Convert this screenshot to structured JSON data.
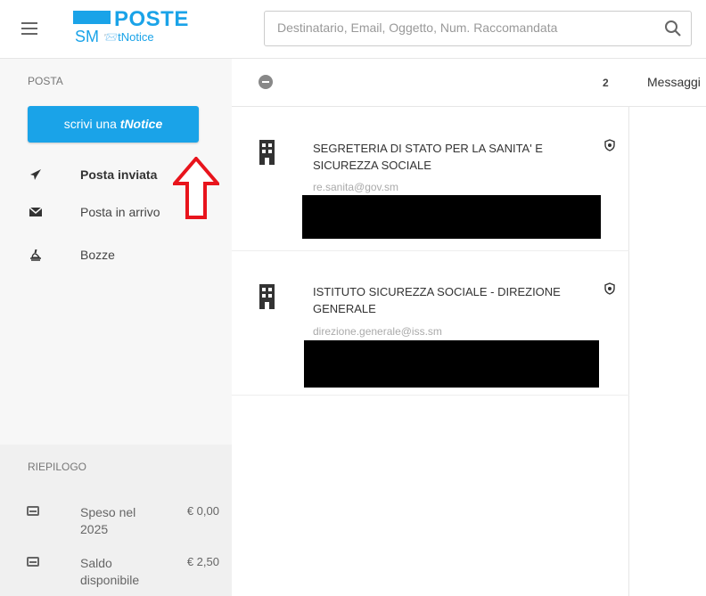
{
  "header": {
    "logo_poste": "POSTE",
    "logo_sm": "SM",
    "logo_tnotice": "📨tNotice",
    "search_placeholder": "Destinatario, Email, Oggetto, Num. Raccomandata"
  },
  "sidebar": {
    "section_label": "POSTA",
    "compose_prefix": "scrivi una ",
    "compose_brand": "tNotice",
    "items": [
      {
        "label": "Posta inviata",
        "icon": "send-icon",
        "active": true
      },
      {
        "label": "Posta in arrivo",
        "icon": "envelope-icon",
        "active": false
      },
      {
        "label": "Bozze",
        "icon": "drafts-icon",
        "active": false
      }
    ],
    "summary_label": "RIEPILOGO",
    "summary": [
      {
        "label": "Speso nel 2025",
        "value": "€ 0,00"
      },
      {
        "label": "Saldo disponibile",
        "value": "€ 2,50"
      }
    ]
  },
  "list": {
    "count": "2",
    "messages_label": "Messaggi",
    "items": [
      {
        "title": "SEGRETERIA DI STATO PER LA SANITA' E SICUREZZA SOCIALE",
        "email": "re.sanita@gov.sm"
      },
      {
        "title": "ISTITUTO SICUREZZA SOCIALE - DIREZIONE GENERALE",
        "email": "direzione.generale@iss.sm"
      }
    ]
  },
  "colors": {
    "brand": "#1aa3e8",
    "annotation_arrow": "#e8141c"
  }
}
